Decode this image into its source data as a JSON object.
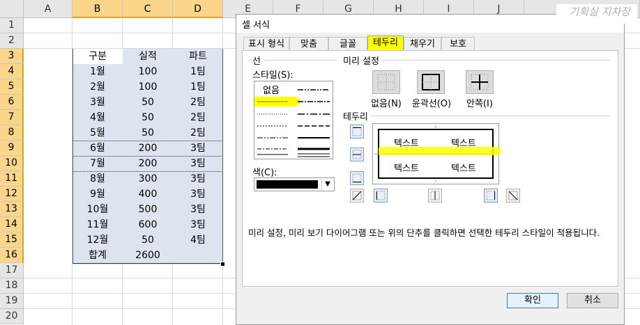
{
  "sheet": {
    "columns": [
      "A",
      "B",
      "C",
      "D",
      "E",
      "F",
      "G",
      "H",
      "I",
      "J"
    ],
    "rows": [
      "1",
      "2",
      "3",
      "4",
      "5",
      "6",
      "7",
      "8",
      "9",
      "10",
      "11",
      "12",
      "13",
      "14",
      "15",
      "16",
      "17",
      "18",
      "19",
      "20"
    ],
    "table": [
      [
        "구분",
        "실적",
        "파트"
      ],
      [
        "1월",
        "100",
        "1팀"
      ],
      [
        "2월",
        "100",
        "1팀"
      ],
      [
        "3월",
        "50",
        "2팀"
      ],
      [
        "4월",
        "50",
        "2팀"
      ],
      [
        "5월",
        "50",
        "2팀"
      ],
      [
        "6월",
        "200",
        "3팀"
      ],
      [
        "7월",
        "200",
        "3팀"
      ],
      [
        "8월",
        "300",
        "3팀"
      ],
      [
        "9월",
        "400",
        "3팀"
      ],
      [
        "10월",
        "500",
        "3팀"
      ],
      [
        "11월",
        "600",
        "3팀"
      ],
      [
        "12월",
        "50",
        "4팀"
      ],
      [
        "합계",
        "2600",
        ""
      ]
    ]
  },
  "watermark": "기획실 지차장",
  "dialog": {
    "title": "셀 서식",
    "tabs": [
      "표시 형식",
      "맞춤",
      "글꼴",
      "테두리",
      "채우기",
      "보호"
    ],
    "active_tab": "테두리",
    "line_group": "선",
    "style_label": "스타일(S):",
    "style_label_key": "S",
    "none_style": "없음",
    "color_label": "색(C):",
    "presets_group": "미리 설정",
    "presets": [
      {
        "label": "없음(N)"
      },
      {
        "label": "윤곽선(O)"
      },
      {
        "label": "안쪽(I)"
      }
    ],
    "border_group": "테두리",
    "preview_text": [
      "텍스트",
      "텍스트",
      "텍스트",
      "텍스트"
    ],
    "hint": "미리 설정, 미리 보기 다이어그램 또는 위의 단추를 클릭하면 선택한 테두리 스타일이 적용됩니다.",
    "ok_label": "확인",
    "cancel_label": "취소",
    "highlight_color": "#ffff00",
    "selected_color": "#000000"
  }
}
